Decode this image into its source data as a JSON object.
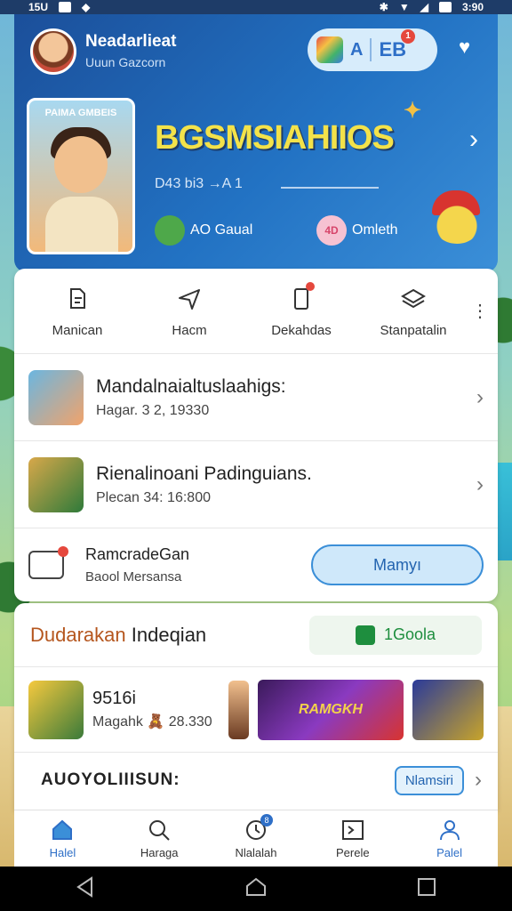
{
  "status": {
    "time_left": "15U",
    "time_right": "3:90"
  },
  "header": {
    "user_name": "Neadarlieat",
    "user_sub": "Uuun Gazcorn",
    "pill_a": "A",
    "pill_b": "EB",
    "pill_badge": "1",
    "banner_card_title": "PAIMA GMBEIS",
    "banner_title": "BGSMSIAHIIOS",
    "banner_progress_label": "D43 bi3 →A 1",
    "chip1_label": "AO Gaual",
    "chip2_badge": "4D",
    "chip2_label": "Omleth"
  },
  "actions": [
    {
      "label": "Manican",
      "icon": "document-icon"
    },
    {
      "label": "Hacm",
      "icon": "send-icon"
    },
    {
      "label": "Dekahdas",
      "icon": "phone-icon"
    },
    {
      "label": "Stanpatalin",
      "icon": "layers-icon"
    }
  ],
  "list": [
    {
      "title": "Mandalnaialtuslaahigs:",
      "sub": "Hagar. 3 2, 19330"
    },
    {
      "title": "Rienalinoani Padinguians.",
      "sub": "Plecan 34: 16:800"
    }
  ],
  "promo": {
    "title": "RamcradeGan",
    "sub": "Baool Mersansa",
    "button": "Mamyı"
  },
  "section": {
    "title_accent": "Dudarakan",
    "title_rest": " Indeqian",
    "button": "1Goola",
    "game_title": "9516i",
    "game_sub": "Magahk 🧸 28.330",
    "tile_big_text": "RAMGKH",
    "foot_title": "AUOYOLIIISUN:",
    "foot_btn": "Nlamsiri"
  },
  "nav": [
    {
      "label": "Halel",
      "icon": "home-icon",
      "active": true
    },
    {
      "label": "Haraga",
      "icon": "search-icon",
      "active": false
    },
    {
      "label": "Nlalalah",
      "icon": "clock-icon",
      "active": false,
      "badge": "8"
    },
    {
      "label": "Perele",
      "icon": "terminal-icon",
      "active": false
    },
    {
      "label": "Palel",
      "icon": "person-icon",
      "active": true
    }
  ]
}
